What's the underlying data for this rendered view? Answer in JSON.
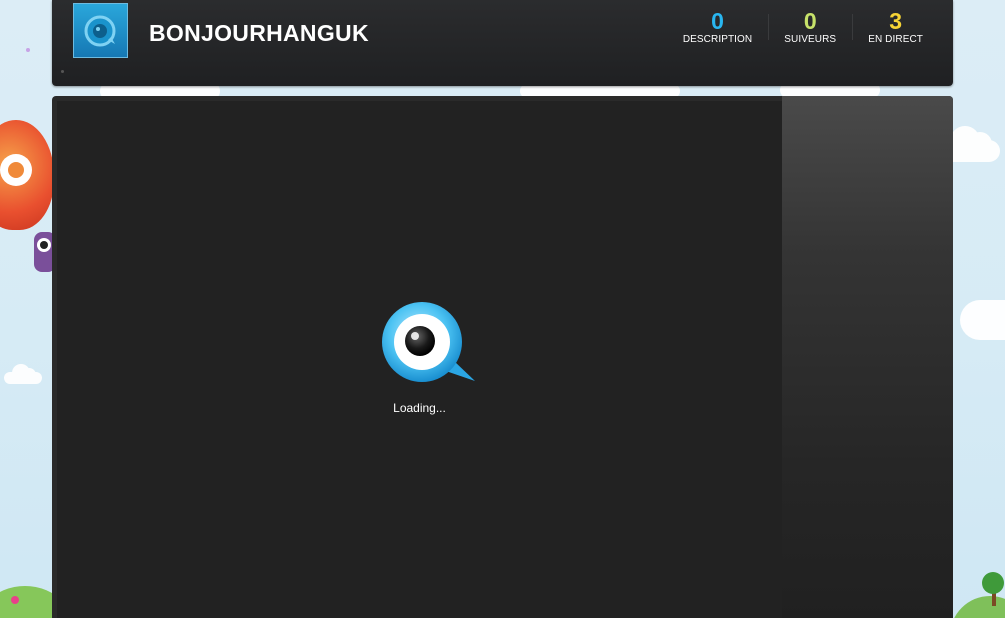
{
  "header": {
    "channel_name": "BONJOURHANGUK",
    "avatar_icon": "bubble-eye-logo-icon"
  },
  "stats": [
    {
      "value": "0",
      "label": "DESCRIPTION",
      "color": "#29b6f0"
    },
    {
      "value": "0",
      "label": "SUIVEURS",
      "color": "#c7e26a"
    },
    {
      "value": "3",
      "label": "EN DIRECT",
      "color": "#f6d335"
    }
  ],
  "player": {
    "loading_text": "Loading...",
    "loader_icon": "bubble-eye-logo-icon"
  },
  "colors": {
    "header_bg": "#1f2022",
    "player_bg": "#222222",
    "accent_blue": "#29b6f0"
  }
}
